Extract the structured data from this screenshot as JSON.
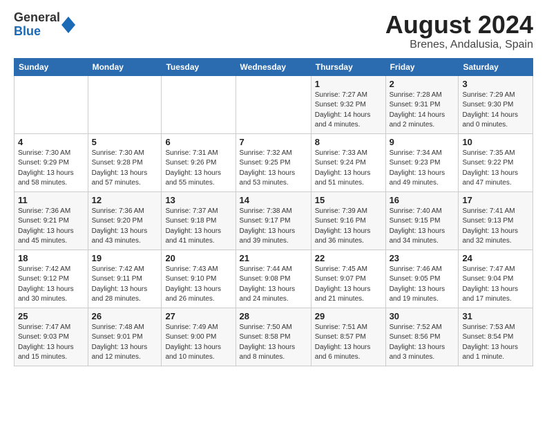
{
  "header": {
    "logo_general": "General",
    "logo_blue": "Blue",
    "month_year": "August 2024",
    "location": "Brenes, Andalusia, Spain"
  },
  "days_of_week": [
    "Sunday",
    "Monday",
    "Tuesday",
    "Wednesday",
    "Thursday",
    "Friday",
    "Saturday"
  ],
  "weeks": [
    [
      {
        "day": "",
        "info": ""
      },
      {
        "day": "",
        "info": ""
      },
      {
        "day": "",
        "info": ""
      },
      {
        "day": "",
        "info": ""
      },
      {
        "day": "1",
        "info": "Sunrise: 7:27 AM\nSunset: 9:32 PM\nDaylight: 14 hours\nand 4 minutes."
      },
      {
        "day": "2",
        "info": "Sunrise: 7:28 AM\nSunset: 9:31 PM\nDaylight: 14 hours\nand 2 minutes."
      },
      {
        "day": "3",
        "info": "Sunrise: 7:29 AM\nSunset: 9:30 PM\nDaylight: 14 hours\nand 0 minutes."
      }
    ],
    [
      {
        "day": "4",
        "info": "Sunrise: 7:30 AM\nSunset: 9:29 PM\nDaylight: 13 hours\nand 58 minutes."
      },
      {
        "day": "5",
        "info": "Sunrise: 7:30 AM\nSunset: 9:28 PM\nDaylight: 13 hours\nand 57 minutes."
      },
      {
        "day": "6",
        "info": "Sunrise: 7:31 AM\nSunset: 9:26 PM\nDaylight: 13 hours\nand 55 minutes."
      },
      {
        "day": "7",
        "info": "Sunrise: 7:32 AM\nSunset: 9:25 PM\nDaylight: 13 hours\nand 53 minutes."
      },
      {
        "day": "8",
        "info": "Sunrise: 7:33 AM\nSunset: 9:24 PM\nDaylight: 13 hours\nand 51 minutes."
      },
      {
        "day": "9",
        "info": "Sunrise: 7:34 AM\nSunset: 9:23 PM\nDaylight: 13 hours\nand 49 minutes."
      },
      {
        "day": "10",
        "info": "Sunrise: 7:35 AM\nSunset: 9:22 PM\nDaylight: 13 hours\nand 47 minutes."
      }
    ],
    [
      {
        "day": "11",
        "info": "Sunrise: 7:36 AM\nSunset: 9:21 PM\nDaylight: 13 hours\nand 45 minutes."
      },
      {
        "day": "12",
        "info": "Sunrise: 7:36 AM\nSunset: 9:20 PM\nDaylight: 13 hours\nand 43 minutes."
      },
      {
        "day": "13",
        "info": "Sunrise: 7:37 AM\nSunset: 9:18 PM\nDaylight: 13 hours\nand 41 minutes."
      },
      {
        "day": "14",
        "info": "Sunrise: 7:38 AM\nSunset: 9:17 PM\nDaylight: 13 hours\nand 39 minutes."
      },
      {
        "day": "15",
        "info": "Sunrise: 7:39 AM\nSunset: 9:16 PM\nDaylight: 13 hours\nand 36 minutes."
      },
      {
        "day": "16",
        "info": "Sunrise: 7:40 AM\nSunset: 9:15 PM\nDaylight: 13 hours\nand 34 minutes."
      },
      {
        "day": "17",
        "info": "Sunrise: 7:41 AM\nSunset: 9:13 PM\nDaylight: 13 hours\nand 32 minutes."
      }
    ],
    [
      {
        "day": "18",
        "info": "Sunrise: 7:42 AM\nSunset: 9:12 PM\nDaylight: 13 hours\nand 30 minutes."
      },
      {
        "day": "19",
        "info": "Sunrise: 7:42 AM\nSunset: 9:11 PM\nDaylight: 13 hours\nand 28 minutes."
      },
      {
        "day": "20",
        "info": "Sunrise: 7:43 AM\nSunset: 9:10 PM\nDaylight: 13 hours\nand 26 minutes."
      },
      {
        "day": "21",
        "info": "Sunrise: 7:44 AM\nSunset: 9:08 PM\nDaylight: 13 hours\nand 24 minutes."
      },
      {
        "day": "22",
        "info": "Sunrise: 7:45 AM\nSunset: 9:07 PM\nDaylight: 13 hours\nand 21 minutes."
      },
      {
        "day": "23",
        "info": "Sunrise: 7:46 AM\nSunset: 9:05 PM\nDaylight: 13 hours\nand 19 minutes."
      },
      {
        "day": "24",
        "info": "Sunrise: 7:47 AM\nSunset: 9:04 PM\nDaylight: 13 hours\nand 17 minutes."
      }
    ],
    [
      {
        "day": "25",
        "info": "Sunrise: 7:47 AM\nSunset: 9:03 PM\nDaylight: 13 hours\nand 15 minutes."
      },
      {
        "day": "26",
        "info": "Sunrise: 7:48 AM\nSunset: 9:01 PM\nDaylight: 13 hours\nand 12 minutes."
      },
      {
        "day": "27",
        "info": "Sunrise: 7:49 AM\nSunset: 9:00 PM\nDaylight: 13 hours\nand 10 minutes."
      },
      {
        "day": "28",
        "info": "Sunrise: 7:50 AM\nSunset: 8:58 PM\nDaylight: 13 hours\nand 8 minutes."
      },
      {
        "day": "29",
        "info": "Sunrise: 7:51 AM\nSunset: 8:57 PM\nDaylight: 13 hours\nand 6 minutes."
      },
      {
        "day": "30",
        "info": "Sunrise: 7:52 AM\nSunset: 8:56 PM\nDaylight: 13 hours\nand 3 minutes."
      },
      {
        "day": "31",
        "info": "Sunrise: 7:53 AM\nSunset: 8:54 PM\nDaylight: 13 hours\nand 1 minute."
      }
    ]
  ]
}
